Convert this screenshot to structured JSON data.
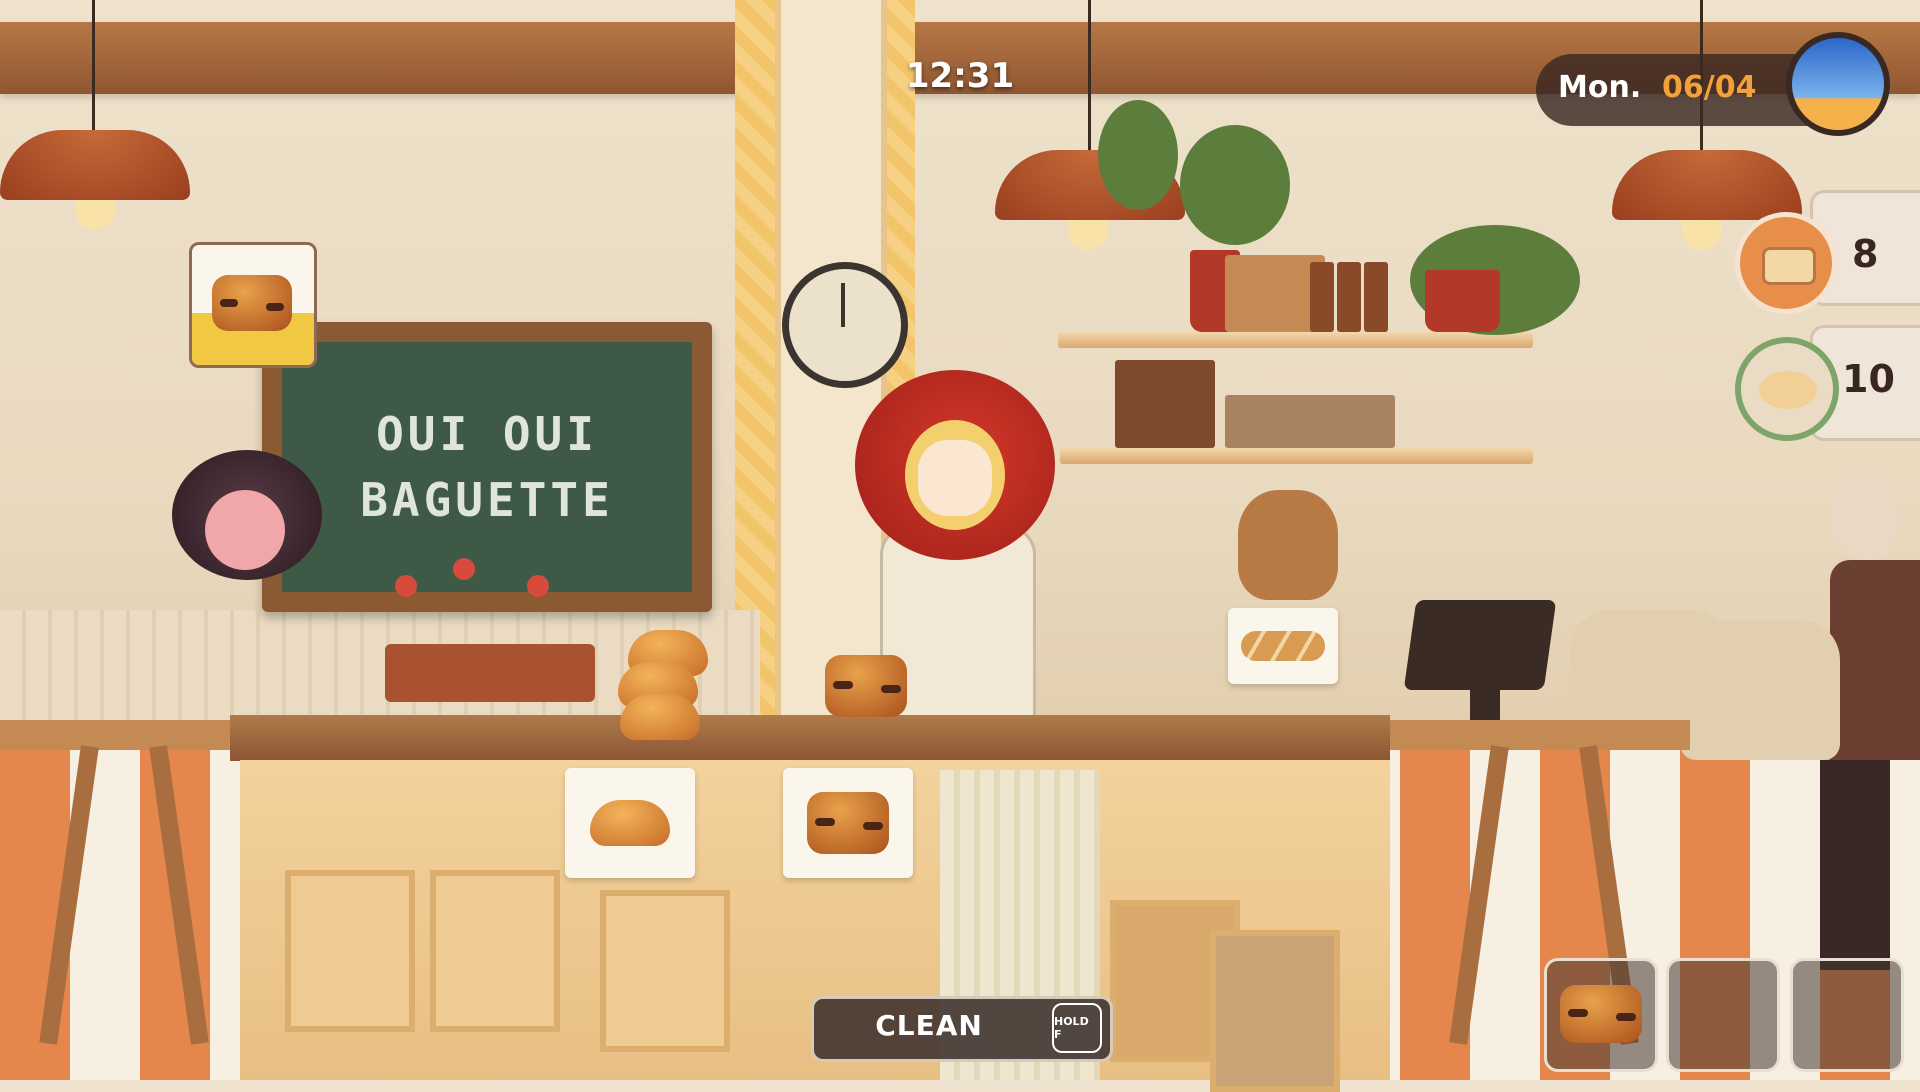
{
  "hud": {
    "time": "12:31",
    "day": "Mon.",
    "date": "06/04"
  },
  "scene": {
    "chalkboard_line1": "OUI OUI",
    "chalkboard_line2": "BAGUETTE"
  },
  "order_request": {
    "item_icon": "pain-au-chocolat-icon"
  },
  "inventory": [
    {
      "name": "bread-slice",
      "icon": "bread-slice-icon",
      "count": "8",
      "ring_color": "#e78f4a"
    },
    {
      "name": "bread-dough",
      "icon": "dough-icon",
      "count": "10",
      "ring_color": "#7fa46a"
    }
  ],
  "action": {
    "label": "CLEAN",
    "key_hint": "HOLD F"
  },
  "hotbar": [
    {
      "item": "pain-au-chocolat-icon"
    },
    {
      "item": ""
    },
    {
      "item": ""
    }
  ],
  "display_items": [
    {
      "icon": "croissant-icon"
    },
    {
      "icon": "pain-au-chocolat-icon"
    },
    {
      "icon": "baguette-icon"
    }
  ]
}
